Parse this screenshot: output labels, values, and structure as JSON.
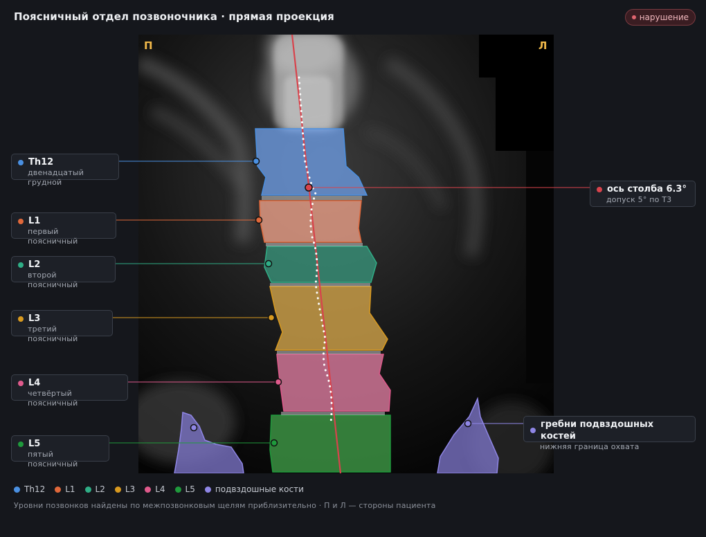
{
  "header": {
    "title": "Поясничный отдел позвоночника · прямая проекция",
    "badge": "нарушение"
  },
  "image": {
    "side_left": "П",
    "side_right": "Л"
  },
  "labels": {
    "th12": {
      "name": "Th12",
      "desc": "двенадцатый грудной",
      "color": "#4a90e2"
    },
    "l1": {
      "name": "L1",
      "desc": "первый поясничный",
      "color": "#e0683a"
    },
    "l2": {
      "name": "L2",
      "desc": "второй поясничный",
      "color": "#2fae86"
    },
    "l3": {
      "name": "L3",
      "desc": "третий поясничный",
      "color": "#d99a1f"
    },
    "l4": {
      "name": "L4",
      "desc": "четвёртый поясничный",
      "color": "#e05a8c"
    },
    "l5": {
      "name": "L5",
      "desc": "пятый поясничный",
      "color": "#1f9a3c"
    },
    "axis": {
      "name": "ось столба 6.3°",
      "desc": "допуск 5° по T3",
      "color": "#d8434c"
    },
    "iliac": {
      "name": "гребни подвздошных костей",
      "desc": "нижняя граница охвата",
      "color": "#8f86e6"
    }
  },
  "legend": {
    "items": [
      {
        "label": "Th12",
        "color": "#4a90e2"
      },
      {
        "label": "L1",
        "color": "#e0683a"
      },
      {
        "label": "L2",
        "color": "#2fae86"
      },
      {
        "label": "L3",
        "color": "#d99a1f"
      },
      {
        "label": "L4",
        "color": "#e05a8c"
      },
      {
        "label": "L5",
        "color": "#1f9a3c"
      },
      {
        "label": "подвздошные кости",
        "color": "#8f86e6"
      }
    ]
  },
  "footnote": "Уровни позвонков найдены по межпозвонковым щелям приблизительно · П и Л — стороны пациента"
}
